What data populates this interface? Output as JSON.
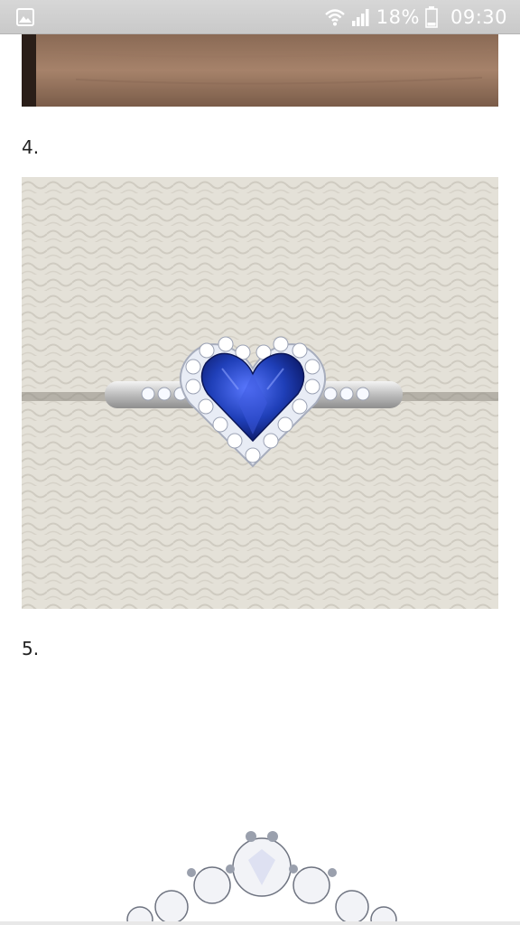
{
  "status_bar": {
    "battery_percent": "18%",
    "time": "09:30",
    "icons": [
      "gallery-icon",
      "wifi-icon",
      "signal-icon",
      "battery-icon"
    ]
  },
  "content": {
    "items": [
      {
        "label": "4."
      },
      {
        "label": "5."
      }
    ]
  },
  "colors": {
    "status_bar_bg": "#cfcfcf",
    "sapphire": "#1f3fb8",
    "background": "#ffffff"
  }
}
